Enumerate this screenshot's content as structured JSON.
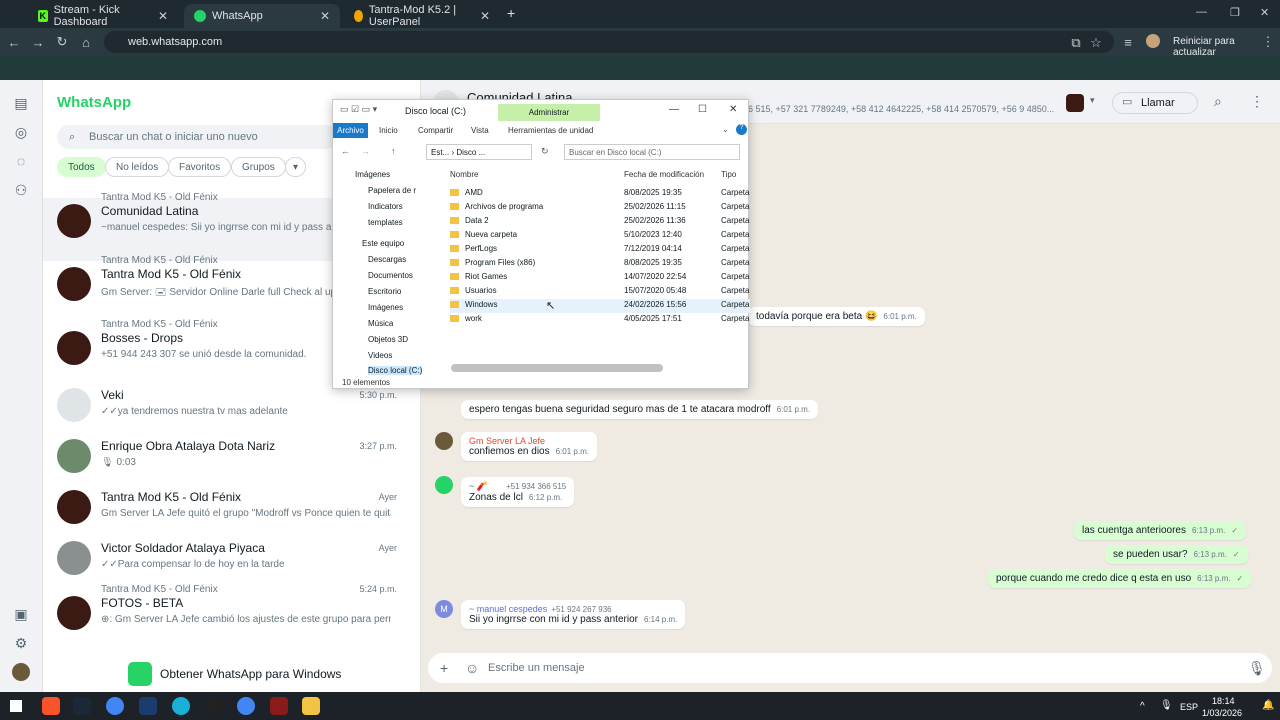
{
  "browser": {
    "tabs": [
      {
        "label": "Stream - Kick Dashboard"
      },
      {
        "label": "WhatsApp"
      },
      {
        "label": "Tantra-Mod K5.2 | UserPanel"
      }
    ],
    "url": "web.whatsapp.com",
    "update_label": "Reiniciar para actualizar"
  },
  "app": {
    "title": "WhatsApp",
    "search_placeholder": "Buscar un chat o iniciar uno nuevo"
  },
  "filters": [
    "Todos",
    "No leídos",
    "Favoritos",
    "Grupos"
  ],
  "chats": [
    {
      "sub": "Tantra Mod K5 - Old Fénix",
      "name": "Comunidad Latina",
      "msg": "~manuel cespedes: Sii yo ingrrse con mi id y pass anterior",
      "time": ""
    },
    {
      "sub": "Tantra Mod K5 - Old Fénix",
      "name": "Tantra Mod K5 - Old Fénix",
      "msg": "Gm Server: 🖃 Servidor Online Darle full Check al update",
      "time": ""
    },
    {
      "sub": "Tantra Mod K5 - Old Fénix",
      "name": "Bosses - Drops",
      "msg": "+51 944 243 307 se unió desde la comunidad.",
      "time": ""
    },
    {
      "sub": "",
      "name": "Veki",
      "msg": "✓✓ya tendremos nuestra tv mas adelante",
      "time": "5:30 p.m."
    },
    {
      "sub": "",
      "name": "Enrique Obra Atalaya Dota Nariz",
      "msg": "🎙 0:03",
      "time": "3:27 p.m."
    },
    {
      "sub": "",
      "name": "Tantra Mod K5 - Old Fénix",
      "msg": "Gm Server LA Jefe quitó el grupo \"Modroff vs Ponce quien te quita ...",
      "time": "Ayer"
    },
    {
      "sub": "",
      "name": "Victor Soldador Atalaya Piyaca",
      "msg": "✓✓Para compensar lo de hoy en la tarde",
      "time": "Ayer"
    },
    {
      "sub": "Tantra Mod K5 - Old Fénix",
      "name": "FOTOS - BETA",
      "msg": "⊕: Gm Server LA Jefe cambió los ajustes de este grupo para permitir ...",
      "time": "5:24 p.m."
    }
  ],
  "get_windows": "Obtener WhatsApp para Windows",
  "conversation": {
    "title": "Comunidad Latina",
    "members": "6 515, +57 321 7789249, +58 412 4642225, +58 414 2570579, +56 9 4850...",
    "call_label": "Llamar",
    "messages": [
      {
        "text": "todavía porque era beta 😆",
        "time": "6:01 p.m."
      },
      {
        "text": "espero tengas buena seguridad seguro mas de 1 te atacara modroff",
        "time": "6:01 p.m."
      },
      {
        "sender": "Gm Server LA Jefe",
        "text": "confiemos en dios",
        "time": "6:01 p.m."
      },
      {
        "sender": "~ 🧨",
        "phone": "+51 934 366 515",
        "text": "Zonas de lcl",
        "time": "6:12 p.m."
      },
      {
        "text": "las cuentga anterioores",
        "time": "6:13 p.m.",
        "out": true
      },
      {
        "text": "se pueden usar?",
        "time": "6:13 p.m.",
        "out": true
      },
      {
        "text": "porque cuando me credo dice q esta en uso",
        "time": "6:13 p.m.",
        "out": true
      },
      {
        "sender": "~ manuel cespedes",
        "phone": "+51 924 267 936",
        "text": "Sii yo ingrrse con mi id y pass anterior",
        "time": "6:14 p.m."
      }
    ],
    "composer_placeholder": "Escribe un mensaje"
  },
  "explorer": {
    "title": "Disco local (C:)",
    "admin": "Administrar",
    "ribbon": [
      "Archivo",
      "Inicio",
      "Compartir",
      "Vista",
      "Herramientas de unidad"
    ],
    "address": "Est... › Disco ...",
    "search": "Buscar en Disco local (C:)",
    "nav": [
      "Imágenes",
      "Papelera de r",
      "Indicators",
      "templates",
      "Este equipo",
      "Descargas",
      "Documentos",
      "Escritorio",
      "Imágenes",
      "Música",
      "Objetos 3D",
      "Videos",
      "Disco local (C:)"
    ],
    "columns": [
      "Nombre",
      "Fecha de modificación",
      "Tipo"
    ],
    "files": [
      {
        "name": "AMD",
        "date": "8/08/2025 19:35",
        "type": "Carpeta"
      },
      {
        "name": "Archivos de programa",
        "date": "25/02/2026 11:15",
        "type": "Carpeta"
      },
      {
        "name": "Data 2",
        "date": "25/02/2026 11:36",
        "type": "Carpeta"
      },
      {
        "name": "Nueva carpeta",
        "date": "5/10/2023 12:40",
        "type": "Carpeta"
      },
      {
        "name": "PerfLogs",
        "date": "7/12/2019 04:14",
        "type": "Carpeta"
      },
      {
        "name": "Program Files (x86)",
        "date": "8/08/2025 19:35",
        "type": "Carpeta"
      },
      {
        "name": "Riot Games",
        "date": "14/07/2020 22:54",
        "type": "Carpeta"
      },
      {
        "name": "Usuarios",
        "date": "15/07/2020 05:48",
        "type": "Carpeta"
      },
      {
        "name": "Windows",
        "date": "24/02/2026 15:56",
        "type": "Carpeta"
      },
      {
        "name": "work",
        "date": "4/05/2025 17:51",
        "type": "Carpeta"
      }
    ],
    "count": "10 elementos"
  },
  "taskbar": {
    "lang": "ESP",
    "time": "18:14",
    "date": "1/03/2026"
  }
}
